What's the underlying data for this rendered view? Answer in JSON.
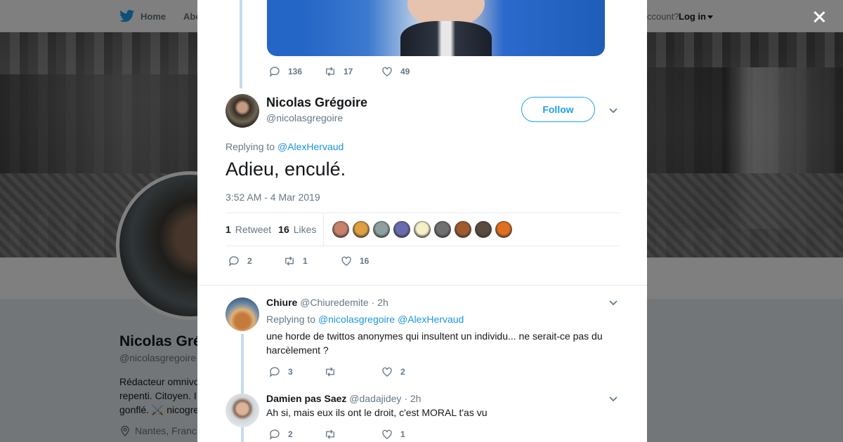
{
  "nav": {
    "home_label": "Home",
    "abo_label": "Abo",
    "account_label": "ccount?",
    "login_label": "Log in"
  },
  "profile": {
    "name": "Nicolas Gré",
    "handle": "@nicolasgregoire",
    "bio_line1": "Rédacteur omnivo",
    "bio_line2": "repenti. Citoyen. I",
    "bio_line3": "gonflé. ⚔️ nicogre",
    "location": "Nantes, Franc"
  },
  "prev_tweet": {
    "replies": "136",
    "retweets": "17",
    "likes": "49"
  },
  "main_tweet": {
    "name": "Nicolas Grégoire",
    "handle": "@nicolasgregoire",
    "follow_label": "Follow",
    "replying_prefix": "Replying to",
    "replying_to": "@AlexHervaud",
    "text": "Adieu, enculé.",
    "timestamp": "3:52 AM - 4 Mar 2019",
    "retweet_count": "1",
    "retweet_label": "Retweet",
    "like_count": "16",
    "like_label": "Likes",
    "liker_colors": [
      "#c9826a",
      "#e0a040",
      "#8fa0a0",
      "#6a6ab0",
      "#f6f0c8",
      "#707070",
      "#a05a2c",
      "#5a4a40",
      "#e07020"
    ],
    "actions": {
      "replies": "2",
      "retweets": "1",
      "likes": "16"
    }
  },
  "replies": [
    {
      "name": "Chiure",
      "handle": "@Chiuredemite",
      "time": "· 2h",
      "replying_prefix": "Replying to",
      "replying_to_1": "@nicolasgregoire",
      "replying_to_2": "@AlexHervaud",
      "text": "une horde de twittos anonymes qui insultent un individu... ne serait-ce pas du harcèlement ?",
      "replies": "3",
      "retweets": "",
      "likes": "2"
    },
    {
      "name": "Damien pas Saez",
      "handle": "@dadajidey",
      "time": "· 2h",
      "text": "Ah si, mais eux ils ont le droit, c'est MORAL t'as vu",
      "replies": "2",
      "retweets": "",
      "likes": "1"
    }
  ]
}
